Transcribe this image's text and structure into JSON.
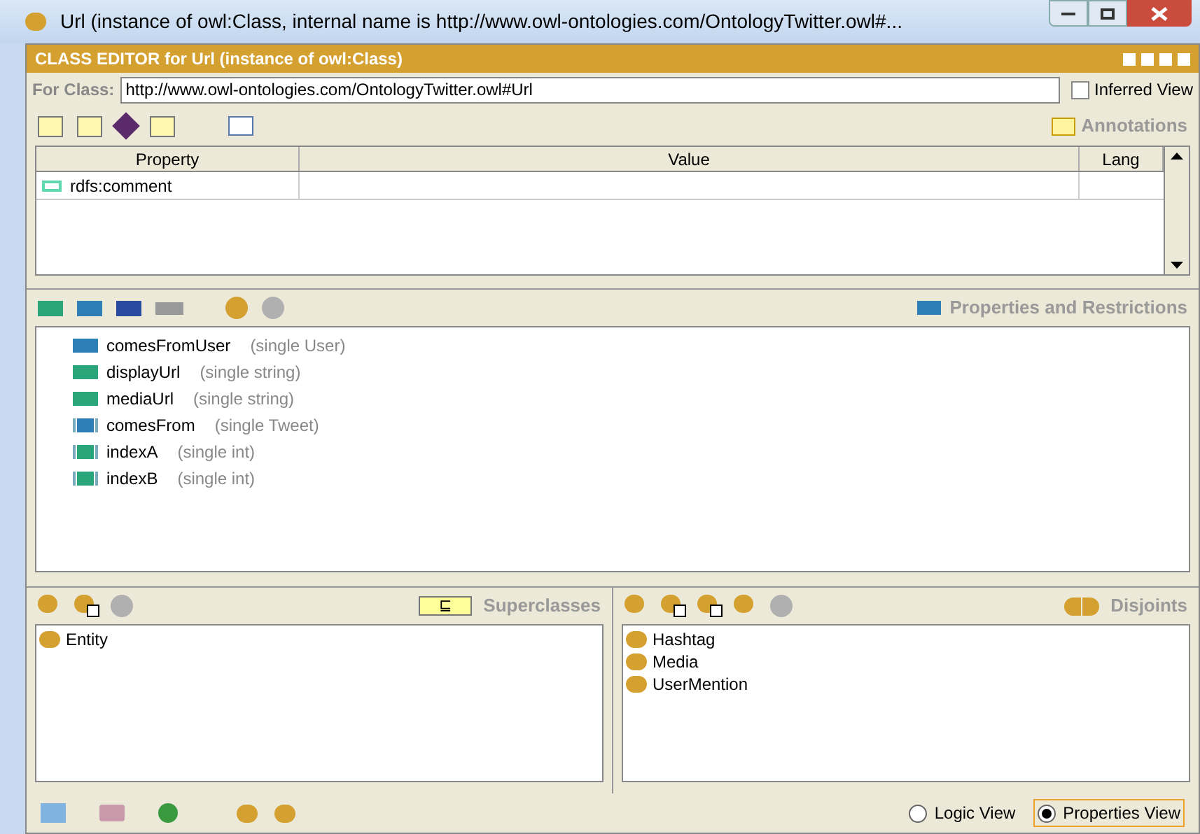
{
  "window": {
    "title": "Url   (instance of owl:Class, internal name is http://www.owl-ontologies.com/OntologyTwitter.owl#..."
  },
  "header": {
    "title": "CLASS EDITOR for Url   (instance of owl:Class)"
  },
  "for_class": {
    "label": "For Class:",
    "value": "http://www.owl-ontologies.com/OntologyTwitter.owl#Url"
  },
  "inferred_view": {
    "label": "Inferred View",
    "checked": false
  },
  "annotations": {
    "label": "Annotations",
    "columns": [
      "Property",
      "Value",
      "Lang"
    ],
    "rows": [
      {
        "property": "rdfs:comment"
      }
    ]
  },
  "properties": {
    "label": "Properties and Restrictions",
    "items": [
      {
        "name": "comesFromUser",
        "detail": "(single User)",
        "kind": "object",
        "bracketed": false
      },
      {
        "name": "displayUrl",
        "detail": "(single string)",
        "kind": "datatype",
        "bracketed": false
      },
      {
        "name": "mediaUrl",
        "detail": "(single string)",
        "kind": "datatype",
        "bracketed": false
      },
      {
        "name": "comesFrom",
        "detail": "(single Tweet)",
        "kind": "object",
        "bracketed": true
      },
      {
        "name": "indexA",
        "detail": "(single int)",
        "kind": "datatype",
        "bracketed": true
      },
      {
        "name": "indexB",
        "detail": "(single int)",
        "kind": "datatype",
        "bracketed": true
      }
    ]
  },
  "superclasses": {
    "symbol": "⊑",
    "label": "Superclasses",
    "items": [
      "Entity"
    ]
  },
  "disjoints": {
    "label": "Disjoints",
    "items": [
      "Hashtag",
      "Media",
      "UserMention"
    ]
  },
  "views": [
    {
      "label": "Logic View",
      "selected": false
    },
    {
      "label": "Properties View",
      "selected": true
    }
  ]
}
